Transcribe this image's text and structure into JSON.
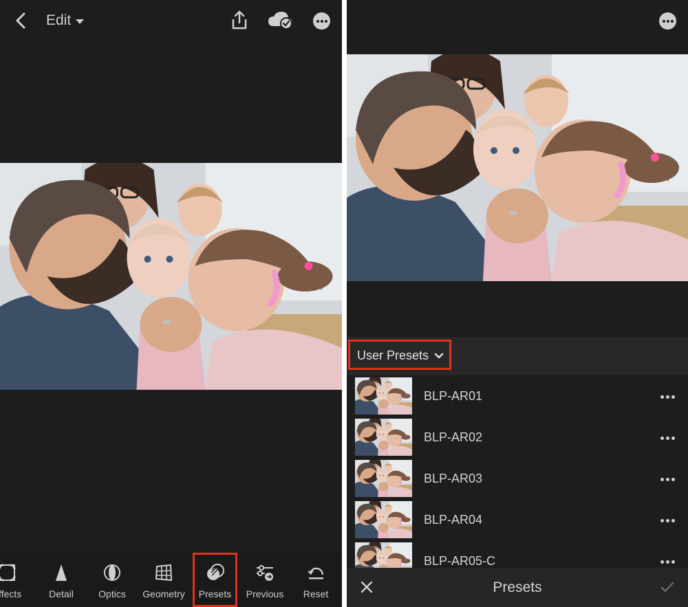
{
  "edit_screen": {
    "title": "Edit",
    "toolbar": [
      {
        "key": "effects",
        "label": "Effects",
        "icon": "vignette-icon"
      },
      {
        "key": "detail",
        "label": "Detail",
        "icon": "sharpen-triangle-icon"
      },
      {
        "key": "optics",
        "label": "Optics",
        "icon": "lens-icon"
      },
      {
        "key": "geometry",
        "label": "Geometry",
        "icon": "grid-icon"
      },
      {
        "key": "presets",
        "label": "Presets",
        "icon": "presets-circles-icon",
        "selected": true
      },
      {
        "key": "previous",
        "label": "Previous",
        "icon": "sliders-previous-icon"
      },
      {
        "key": "reset",
        "label": "Reset",
        "icon": "undo-arrow-icon"
      }
    ]
  },
  "presets_screen": {
    "group_label": "User Presets",
    "presets": [
      {
        "name": "BLP-AR01"
      },
      {
        "name": "BLP-AR02"
      },
      {
        "name": "BLP-AR03"
      },
      {
        "name": "BLP-AR04"
      },
      {
        "name": "BLP-AR05-C"
      }
    ],
    "footer_title": "Presets"
  },
  "colors": {
    "panel_background": "#1d1d1d",
    "list_header_background": "#282828",
    "highlight_outline": "#e0331b",
    "text": "#d4d4d4"
  }
}
